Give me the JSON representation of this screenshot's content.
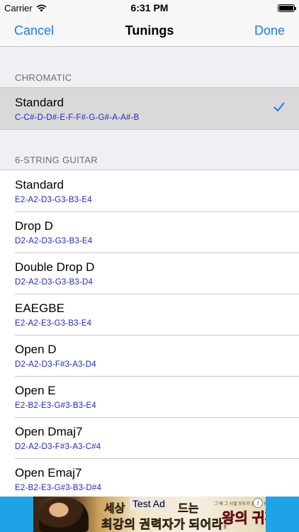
{
  "status_bar": {
    "carrier": "Carrier",
    "time": "6:31 PM",
    "icons": [
      "wifi-icon",
      "battery-icon"
    ]
  },
  "nav": {
    "cancel_label": "Cancel",
    "title": "Tunings",
    "done_label": "Done"
  },
  "colors": {
    "accent": "#1a7cf6",
    "notes": "#1c28c9",
    "selected_row": "#d9d9d9",
    "ad_background": "#1fa3e6"
  },
  "sections": [
    {
      "header": "CHROMATIC",
      "items": [
        {
          "name": "Standard",
          "notes": "C-C#-D-D#-E-F-F#-G-G#-A-A#-B",
          "selected": true
        }
      ]
    },
    {
      "header": "6-STRING GUITAR",
      "items": [
        {
          "name": "Standard",
          "notes": "E2-A2-D3-G3-B3-E4"
        },
        {
          "name": "Drop D",
          "notes": "D2-A2-D3-G3-B3-E4"
        },
        {
          "name": "Double Drop D",
          "notes": "D2-A2-D3-G3-B3-D4"
        },
        {
          "name": "EAEGBE",
          "notes": "E2-A2-E3-G3-B3-E4"
        },
        {
          "name": "Open D",
          "notes": "D2-A2-D3-F#3-A3-D4"
        },
        {
          "name": "Open E",
          "notes": "E2-B2-E3-G#3-B3-E4"
        },
        {
          "name": "Open Dmaj7",
          "notes": "D2-A2-D3-F#3-A3-C#4"
        },
        {
          "name": "Open Emaj7",
          "notes": "E2-B2-E3-G#3-B3-D#4"
        }
      ]
    }
  ],
  "ad": {
    "label": "Test Ad",
    "headline_left": "세상",
    "headline_right": "드는",
    "headline_line2": "최강의 권력자가 되어라!",
    "game_subtitle": "그 때 그 시절 모두가 즐기던 RPG",
    "game_logo": "왕의 귀환",
    "info_glyph": "i"
  }
}
